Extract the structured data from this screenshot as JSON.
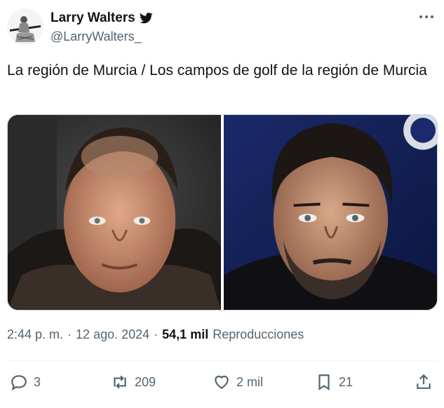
{
  "author": {
    "display_name": "Larry Walters",
    "handle": "@LarryWalters_"
  },
  "tweet": {
    "text": "La región de Murcia / Los campos de golf de la región de Murcia"
  },
  "meta": {
    "time": "2:44 p. m.",
    "separator": "·",
    "date": "12 ago. 2024",
    "views_count": "54,1 mil",
    "views_label": "Reproducciones"
  },
  "actions": {
    "replies": "3",
    "reposts": "209",
    "likes": "2 mil",
    "bookmarks": "21"
  },
  "icons": {
    "verified": "twitter-bird-icon",
    "more": "more-icon",
    "reply": "reply-icon",
    "repost": "repost-icon",
    "like": "heart-icon",
    "bookmark": "bookmark-icon",
    "share": "share-icon"
  },
  "colors": {
    "text": "#0f1419",
    "muted": "#536471",
    "border": "#cfd9de"
  }
}
